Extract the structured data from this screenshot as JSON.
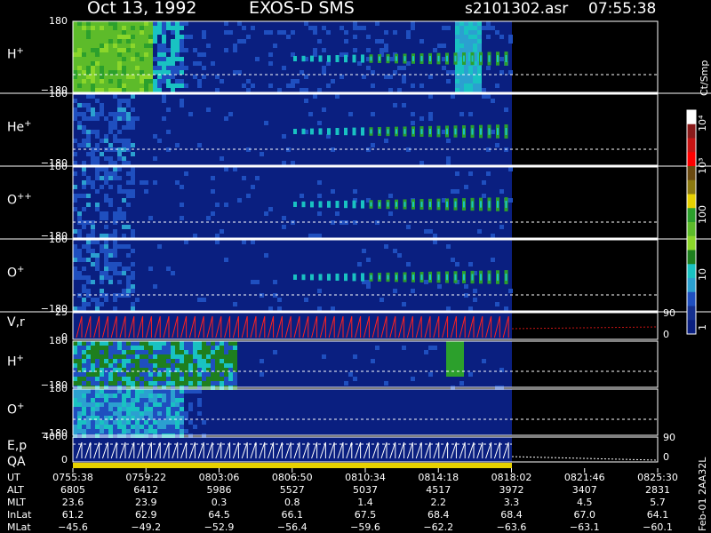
{
  "header": {
    "date": "Oct 13, 1992",
    "instrument": "EXOS-D SMS",
    "file": "s2101302.asr",
    "time": "07:55:38"
  },
  "colorbar": {
    "unit": "Ct/Smp",
    "ticks": [
      "10⁴",
      "10³",
      "100",
      "10",
      "1"
    ],
    "colors": [
      "#ffffff",
      "#8a1a1a",
      "#c81414",
      "#ff0000",
      "#6b4a10",
      "#8c7a10",
      "#e6d000",
      "#2ca02c",
      "#5dbb2a",
      "#8bd62a",
      "#1e7f1e",
      "#19c2c2",
      "#2ba0d0",
      "#1f4fbf",
      "#15308f",
      "#0a1f80"
    ]
  },
  "panels": [
    {
      "label": "H",
      "sup": "+",
      "ymax": "180",
      "ymin": "−180"
    },
    {
      "label": "He",
      "sup": "+",
      "ymax": "180",
      "ymin": "−180"
    },
    {
      "label": "O",
      "sup": "++",
      "ymax": "180",
      "ymin": "−180"
    },
    {
      "label": "O",
      "sup": "+",
      "ymax": "180",
      "ymin": "−180"
    },
    {
      "label": "V,r",
      "sup": "",
      "ymax": "25",
      "ymin": "0",
      "rmax": "90",
      "rmin": "0"
    },
    {
      "label": "H",
      "sup": "+",
      "ymax": "180",
      "ymin": "−180"
    },
    {
      "label": "O",
      "sup": "+",
      "ymax": "180",
      "ymin": "−180"
    },
    {
      "label": "E,p",
      "sup": "",
      "ymax": "4000",
      "ymin": "0",
      "rmax": "90",
      "rmin": "0"
    }
  ],
  "qa_label": "QA",
  "side_id": "Feb-01 2AA32L",
  "chart_data": {
    "type": "heatmap",
    "title": "Oct 13, 1992   EXOS-D SMS",
    "x": [
      "0755:38",
      "0759:22",
      "0803:06",
      "0806:50",
      "0810:34",
      "0814:18",
      "0818:02",
      "0821:46",
      "0825:30"
    ],
    "ylim": [
      -180,
      180
    ],
    "legend_unit": "Ct/Smp",
    "rows": [
      {
        "name": "UT",
        "values": [
          "0755:38",
          "0759:22",
          "0803:06",
          "0806:50",
          "0810:34",
          "0814:18",
          "0818:02",
          "0821:46",
          "0825:30"
        ]
      },
      {
        "name": "ALT",
        "values": [
          "6805",
          "6412",
          "5986",
          "5527",
          "5037",
          "4517",
          "3972",
          "3407",
          "2831"
        ]
      },
      {
        "name": "MLT",
        "values": [
          "23.6",
          "23.9",
          "0.3",
          "0.8",
          "1.4",
          "2.2",
          "3.3",
          "4.5",
          "5.7"
        ]
      },
      {
        "name": "InLat",
        "values": [
          "61.2",
          "62.9",
          "64.5",
          "66.1",
          "67.5",
          "68.4",
          "68.4",
          "67.0",
          "64.1"
        ]
      },
      {
        "name": "MLat",
        "values": [
          "−45.6",
          "−49.2",
          "−52.9",
          "−56.4",
          "−59.6",
          "−62.2",
          "−63.6",
          "−63.1",
          "−60.1"
        ]
      }
    ]
  }
}
